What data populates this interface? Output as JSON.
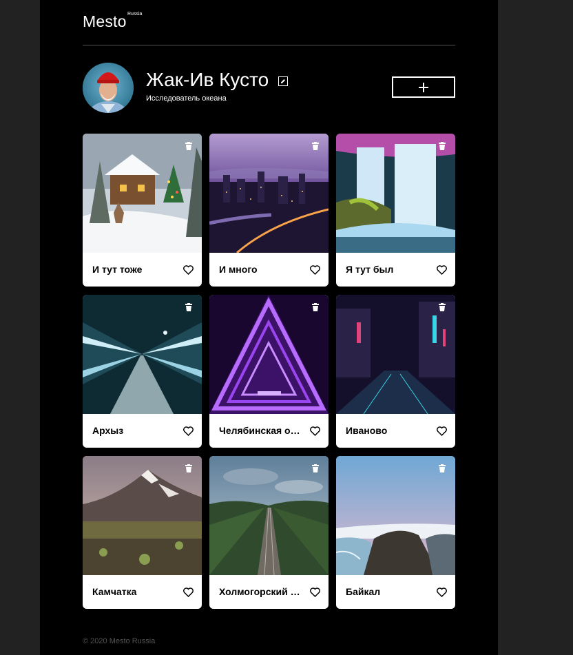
{
  "header": {
    "logo": "Mesto",
    "logo_sub": "Russia"
  },
  "profile": {
    "name": "Жак-Ив Кусто",
    "about": "Исследователь океана",
    "avatar_icon": "portrait-man-red-cap",
    "edit_icon": "pencil-icon",
    "add_icon": "plus-icon"
  },
  "cards": [
    {
      "title": "И тут тоже",
      "image": "snowy-house-scene",
      "liked": false
    },
    {
      "title": "И много",
      "image": "city-evening-purple",
      "liked": false
    },
    {
      "title": "Я тут был",
      "image": "waterfall-flowers",
      "liked": false
    },
    {
      "title": "Архыз",
      "image": "airport-moving-walkway",
      "liked": false
    },
    {
      "title": "Челябинская о…",
      "image": "neon-triangle-tunnel",
      "liked": false
    },
    {
      "title": "Иваново",
      "image": "neon-city-street-night",
      "liked": false
    },
    {
      "title": "Камчатка",
      "image": "volcano-tundra",
      "liked": false
    },
    {
      "title": "Холмогорский …",
      "image": "railway-forest",
      "liked": false
    },
    {
      "title": "Байкал",
      "image": "coast-cliff-lake",
      "liked": false
    }
  ],
  "footer": {
    "copyright": "© 2020 Mesto Russia"
  }
}
